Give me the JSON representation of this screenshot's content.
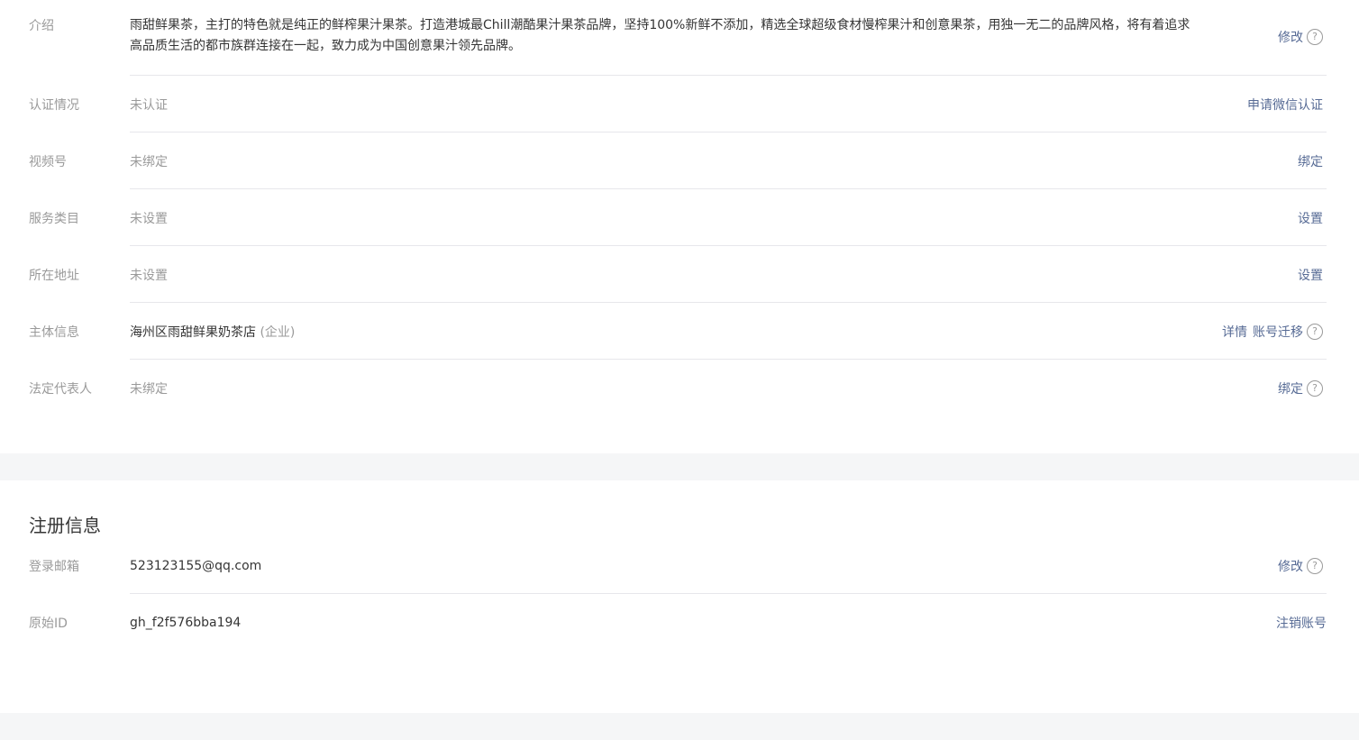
{
  "basic_info": {
    "rows": [
      {
        "label": "介绍",
        "value": "雨甜鲜果茶，主打的特色就是纯正的鲜榨果汁果茶。打造港城最Chill潮酷果汁果茶品牌，坚持100%新鲜不添加，精选全球超级食材慢榨果汁和创意果茶，用独一无二的品牌风格，将有着追求高品质生活的都市族群连接在一起，致力成为中国创意果汁领先品牌。",
        "action": "修改"
      },
      {
        "label": "认证情况",
        "value": "未认证",
        "action": "申请微信认证"
      },
      {
        "label": "视频号",
        "value": "未绑定",
        "action": "绑定"
      },
      {
        "label": "服务类目",
        "value": "未设置",
        "action": "设置"
      },
      {
        "label": "所在地址",
        "value": "未设置",
        "action": "设置"
      },
      {
        "label": "主体信息",
        "value": "海州区雨甜鲜果奶茶店",
        "value_sub": "(企业)",
        "action": "详情",
        "action2": "账号迁移"
      },
      {
        "label": "法定代表人",
        "value": "未绑定",
        "action": "绑定"
      }
    ]
  },
  "register_info": {
    "title": "注册信息",
    "rows": [
      {
        "label": "登录邮箱",
        "value": "523123155@qq.com",
        "action": "修改"
      },
      {
        "label": "原始ID",
        "value": "gh_f2f576bba194",
        "action": "注销账号"
      }
    ]
  },
  "icons": {
    "help": "?"
  },
  "colors": {
    "link": "#576b95",
    "label": "#9a9a9a",
    "text": "#353535",
    "divider": "#e7e7eb",
    "page_bg": "#f5f6f7"
  }
}
